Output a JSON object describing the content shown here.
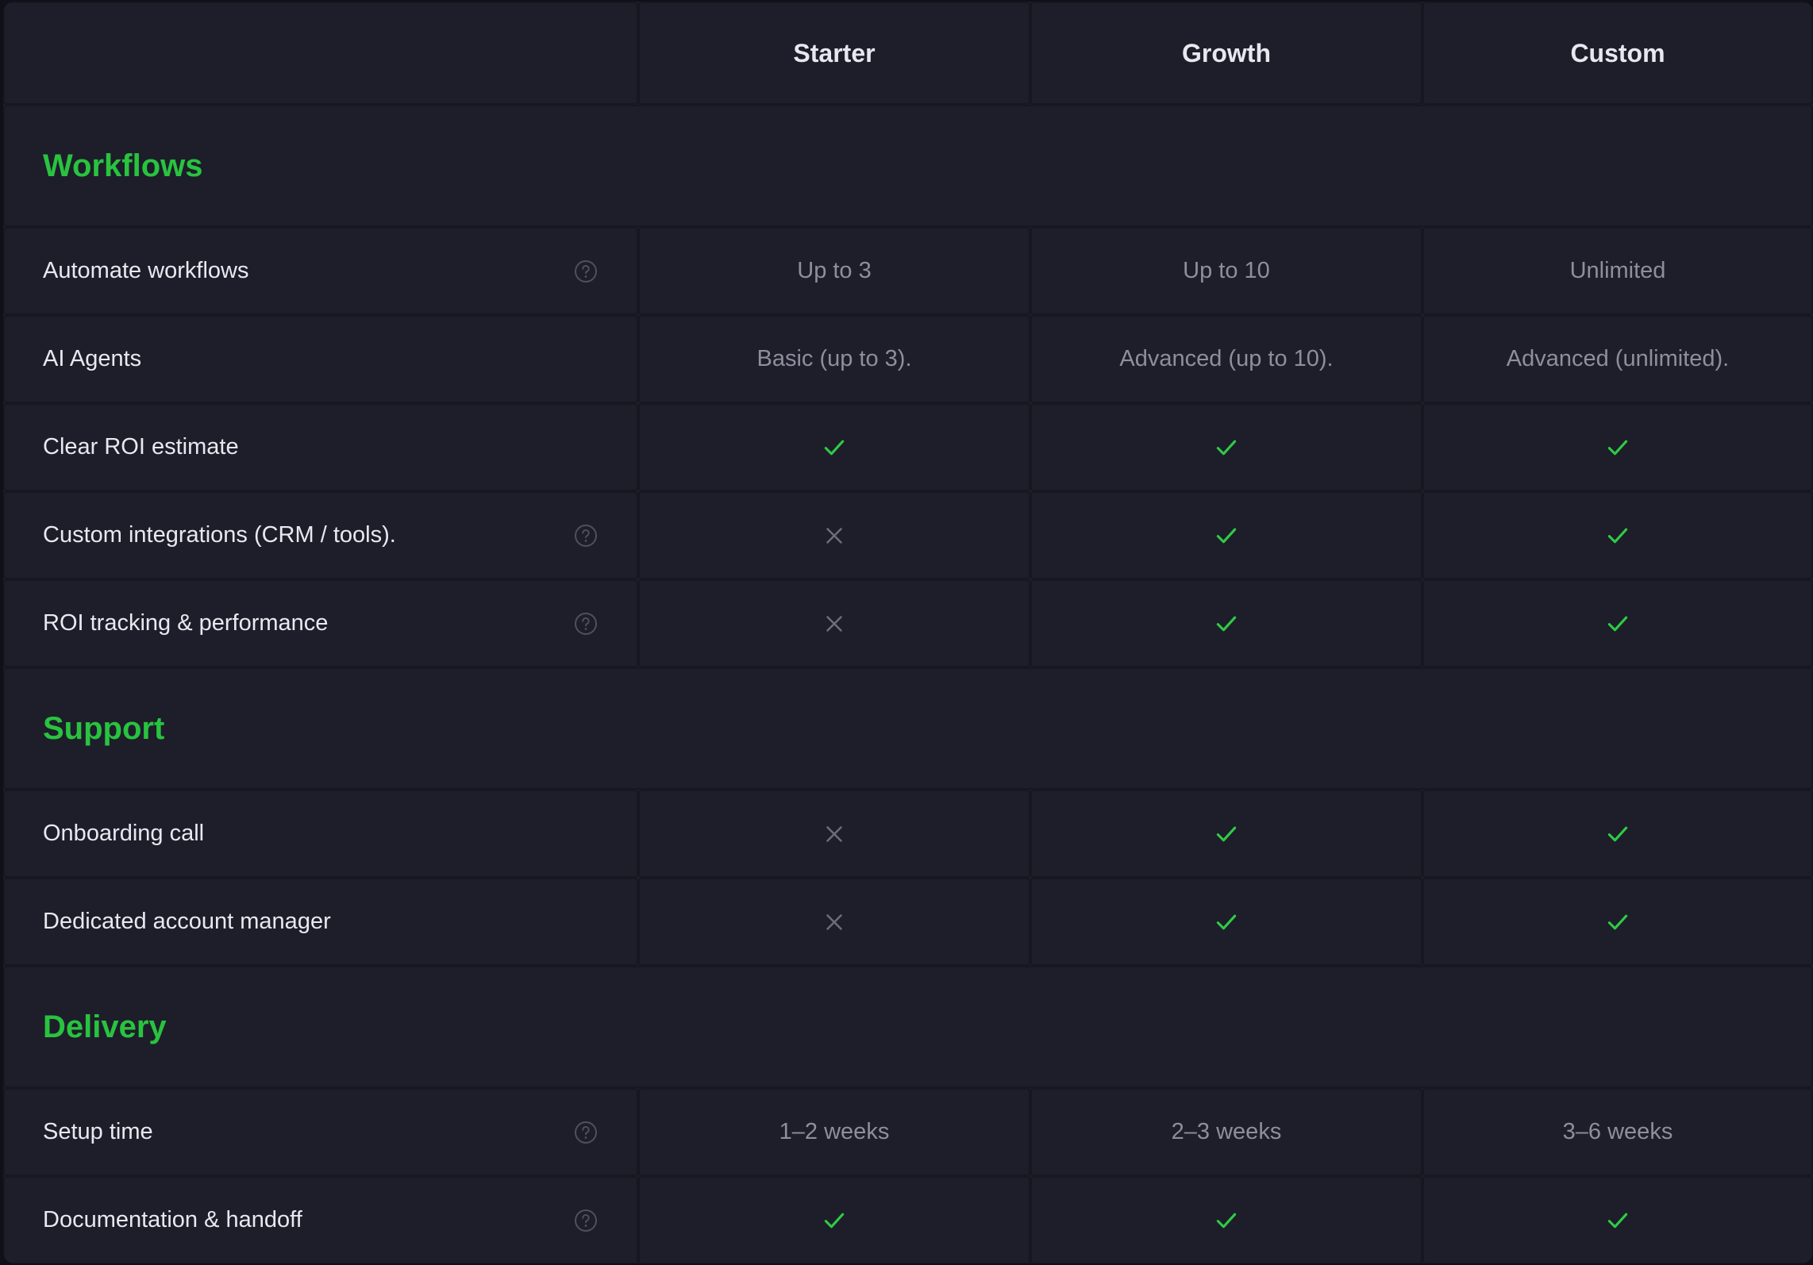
{
  "plans": [
    "Starter",
    "Growth",
    "Custom"
  ],
  "colors": {
    "accent": "#29c33f",
    "check": "#2fcb45",
    "cross": "#6b6d7b",
    "background": "#1d1e2a",
    "grid": "#161720"
  },
  "sections": [
    {
      "title": "Workflows",
      "rows": [
        {
          "label": "Automate workflows",
          "help": true,
          "values": [
            {
              "text": "Up to 3"
            },
            {
              "text": "Up to 10"
            },
            {
              "text": "Unlimited"
            }
          ]
        },
        {
          "label": "AI Agents",
          "help": false,
          "values": [
            {
              "text": "Basic (up to 3)."
            },
            {
              "text": "Advanced (up to 10)."
            },
            {
              "text": "Advanced (unlimited)."
            }
          ]
        },
        {
          "label": "Clear ROI estimate",
          "help": false,
          "values": [
            {
              "icon": "check-icon"
            },
            {
              "icon": "check-icon"
            },
            {
              "icon": "check-icon"
            }
          ]
        },
        {
          "label": "Custom integrations (CRM / tools).",
          "help": true,
          "values": [
            {
              "icon": "cross-icon"
            },
            {
              "icon": "check-icon"
            },
            {
              "icon": "check-icon"
            }
          ]
        },
        {
          "label": "ROI tracking & performance",
          "help": true,
          "values": [
            {
              "icon": "cross-icon"
            },
            {
              "icon": "check-icon"
            },
            {
              "icon": "check-icon"
            }
          ]
        }
      ]
    },
    {
      "title": "Support",
      "rows": [
        {
          "label": "Onboarding call",
          "help": false,
          "values": [
            {
              "icon": "cross-icon"
            },
            {
              "icon": "check-icon"
            },
            {
              "icon": "check-icon"
            }
          ]
        },
        {
          "label": "Dedicated account manager",
          "help": false,
          "values": [
            {
              "icon": "cross-icon"
            },
            {
              "icon": "check-icon"
            },
            {
              "icon": "check-icon"
            }
          ]
        }
      ]
    },
    {
      "title": "Delivery",
      "rows": [
        {
          "label": "Setup time",
          "help": true,
          "values": [
            {
              "text": "1–2 weeks"
            },
            {
              "text": "2–3 weeks"
            },
            {
              "text": "3–6 weeks"
            }
          ]
        },
        {
          "label": "Documentation & handoff",
          "help": true,
          "values": [
            {
              "icon": "check-icon"
            },
            {
              "icon": "check-icon"
            },
            {
              "icon": "check-icon"
            }
          ]
        }
      ]
    }
  ]
}
